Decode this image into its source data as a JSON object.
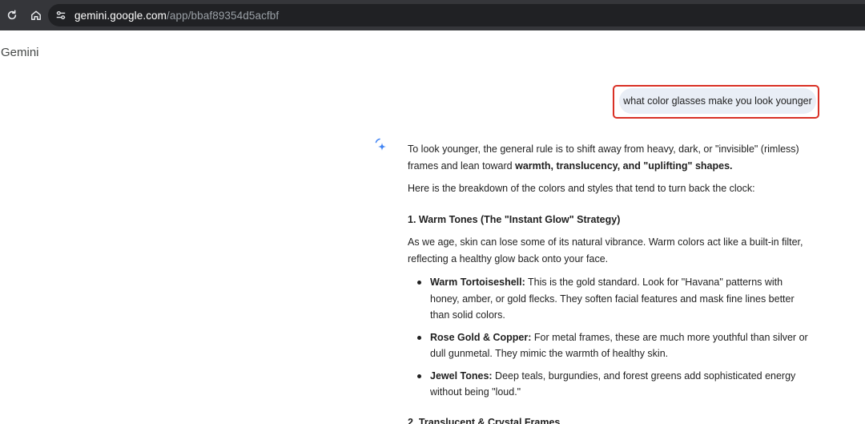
{
  "browser": {
    "url_host": "gemini.google.com",
    "url_path": "/app/bbaf89354d5acfbf"
  },
  "app": {
    "title": "Gemini"
  },
  "chat": {
    "user_prompt": "what color glasses make you look younger",
    "response": {
      "intro_plain": "To look younger, the general rule is to shift away from heavy, dark, or \"invisible\" (rimless) frames and lean toward ",
      "intro_bold": "warmth, translucency, and \"uplifting\" shapes.",
      "breakdown": "Here is the breakdown of the colors and styles that tend to turn back the clock:",
      "section1": {
        "heading": "1. Warm Tones (The \"Instant Glow\" Strategy)",
        "body": "As we age, skin can lose some of its natural vibrance. Warm colors act like a built-in filter, reflecting a healthy glow back onto your face.",
        "bullets": [
          {
            "bold": "Warm Tortoiseshell:",
            "text": " This is the gold standard. Look for \"Havana\" patterns with honey, amber, or gold flecks. They soften facial features and mask fine lines better than solid colors."
          },
          {
            "bold": "Rose Gold & Copper:",
            "text": " For metal frames, these are much more youthful than silver or dull gunmetal. They mimic the warmth of healthy skin."
          },
          {
            "bold": "Jewel Tones:",
            "text": " Deep teals, burgundies, and forest greens add sophisticated energy without being \"loud.\""
          }
        ]
      },
      "section2": {
        "heading": "2. Translucent & Crystal Frames"
      }
    }
  },
  "icons": {
    "reload": "reload-icon",
    "home": "home-icon",
    "site_info": "tune-icon",
    "spark": "gemini-spark-icon"
  },
  "colors": {
    "browser_bar": "#35363a",
    "url_pill": "#202124",
    "user_bubble": "#e9eef6",
    "highlight": "#d93025",
    "spark_blue": "#4285f4"
  }
}
